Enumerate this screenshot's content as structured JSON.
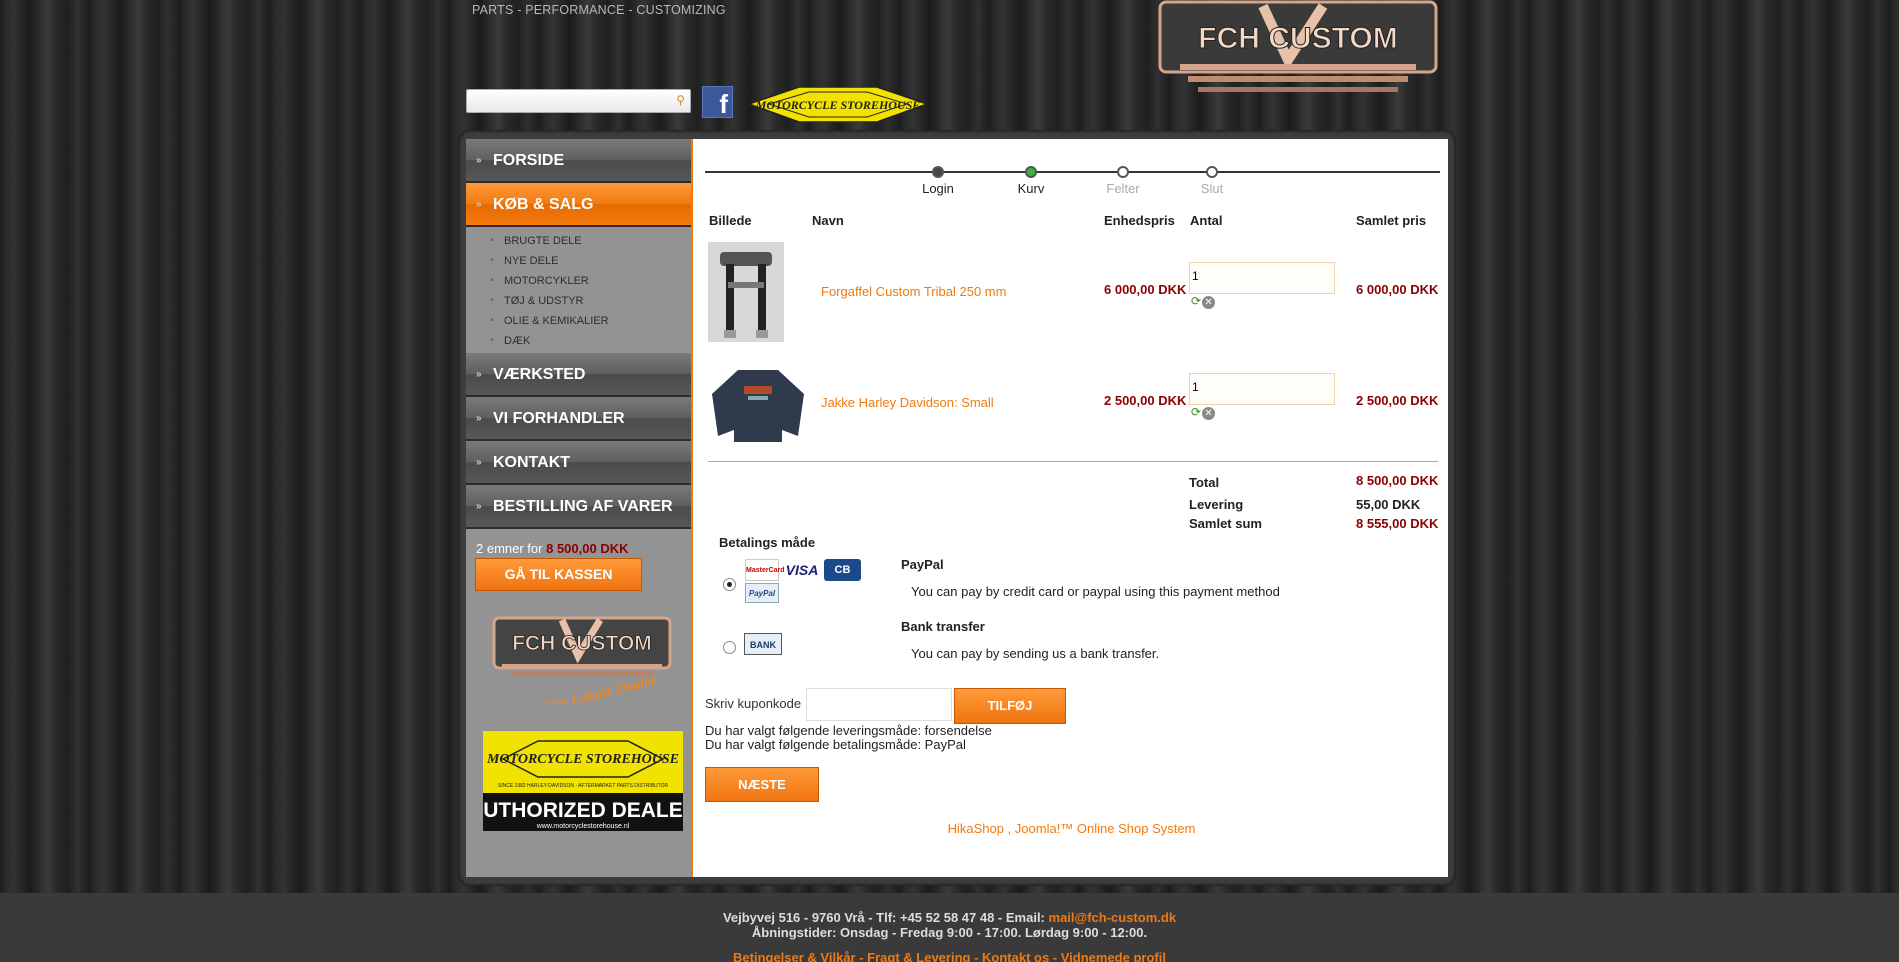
{
  "header": {
    "tagline": "PARTS - PERFORMANCE - CUSTOMIZING",
    "search_placeholder": "",
    "facebook_icon": "facebook-icon",
    "storehouse_logo_text": "MOTORCYCLE STOREHOUSE",
    "logo_text": "FCH CUSTOM"
  },
  "sidebar": {
    "nav": [
      {
        "label": "FORSIDE"
      },
      {
        "label": "KØB & SALG",
        "active": true
      },
      {
        "label": "VÆRKSTED"
      },
      {
        "label": "VI FORHANDLER"
      },
      {
        "label": "KONTAKT"
      },
      {
        "label": "BESTILLING AF VARER"
      }
    ],
    "sub_items": [
      "BRUGTE DELE",
      "NYE DELE",
      "MOTORCYKLER",
      "TØJ & UDSTYR",
      "OLIE & KEMIKALIER",
      "DÆK"
    ],
    "cart_summary_prefix": "2 emner for",
    "cart_summary_amount": "8 500,00 DKK",
    "checkout_label": "GÅ TIL KASSEN",
    "side_logo_text": "FCH CUSTOM",
    "side_logo_script": "Din Lokale Dealer",
    "dealer_banner_brand": "MOTORCYCLE STOREHOUSE",
    "dealer_banner_small": "SINCE 1982 HARLEY-DAVIDSON · AFTERMARKET PARTS DISTRIBUTOR",
    "dealer_banner_main": "AUTHORIZED DEALER",
    "dealer_banner_url": "www.motorcyclestorehouse.nl"
  },
  "steps": [
    {
      "label": "Login",
      "state": "done"
    },
    {
      "label": "Kurv",
      "state": "current"
    },
    {
      "label": "Felter",
      "state": "pending"
    },
    {
      "label": "Slut",
      "state": "pending"
    }
  ],
  "cart": {
    "headers": {
      "image": "Billede",
      "name": "Navn",
      "unit_price": "Enhedspris",
      "qty": "Antal",
      "total": "Samlet pris"
    },
    "items": [
      {
        "name": "Forgaffel Custom Tribal 250 mm",
        "unit_price": "6 000,00 DKK",
        "qty": "1",
        "total": "6 000,00 DKK"
      },
      {
        "name": "Jakke Harley Davidson: Small",
        "unit_price": "2 500,00 DKK",
        "qty": "1",
        "total": "2 500,00 DKK"
      }
    ],
    "totals": {
      "total_label": "Total",
      "total_value": "8 500,00 DKK",
      "shipping_label": "Levering",
      "shipping_value": "55,00 DKK",
      "grand_label": "Samlet sum",
      "grand_value": "8 555,00 DKK"
    }
  },
  "payment": {
    "title": "Betalings måde",
    "methods": [
      {
        "name": "PayPal",
        "description": "You can pay by credit card or paypal using this payment method",
        "selected": true
      },
      {
        "name": "Bank transfer",
        "description": "You can pay by sending us a bank transfer.",
        "selected": false
      }
    ],
    "card_logos": {
      "mastercard": "MasterCard",
      "visa": "VISA",
      "cb": "CB",
      "paypal": "PayPal",
      "bank": "BANK"
    }
  },
  "coupon": {
    "label": "Skriv kuponkode",
    "value": "",
    "button": "TILFØJ"
  },
  "info": {
    "shipping_line": "Du har valgt følgende leveringsmåde: forsendelse",
    "payment_line": "Du har valgt følgende betalingsmåde: PayPal"
  },
  "next_button": "NÆSTE",
  "powered_by": "HikaShop , Joomla!™ Online Shop System",
  "footer": {
    "address": "Vejbyvej 516 - 9760 Vrå - Tlf: +45 52 58 47 48 - Email:",
    "email": "mail@fch-custom.dk",
    "hours": "Åbningstider: Onsdag - Fredag 9:00 - 17:00. Lørdag 9:00 - 12:00.",
    "links": "Betingelser & Vilkår - Fragt & Levering - Kontakt os - Vidnemede profil"
  },
  "colors": {
    "accent": "#f07a10",
    "price": "#8b0000",
    "sidebar": "#939393",
    "active_step": "#3cb043"
  }
}
